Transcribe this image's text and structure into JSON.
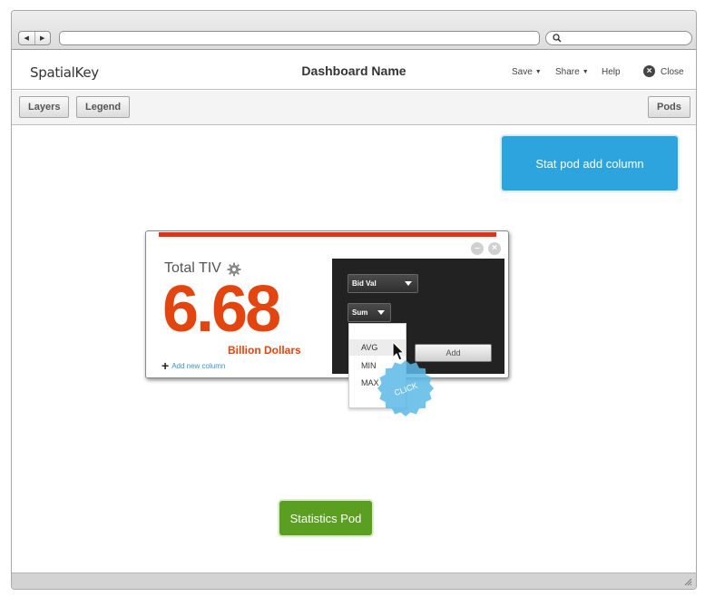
{
  "header": {
    "logo": "SpatialKey",
    "dashboard_name": "Dashboard Name",
    "menu": [
      {
        "label": "Save",
        "has_caret": true
      },
      {
        "label": "Share",
        "has_caret": true
      },
      {
        "label": "Help",
        "has_caret": false
      }
    ],
    "close_label": "Close",
    "close_icon": "×"
  },
  "toolbar": {
    "layers_label": "Layers",
    "legend_label": "Legend",
    "pods_label": "Pods"
  },
  "notes": {
    "blue": "Stat pod add column",
    "green": "Statistics Pod",
    "blue_color": "#2ea4de",
    "green_color": "#5a9e22"
  },
  "pod": {
    "title": "Total TIV",
    "value": "6.68",
    "units": "Billion Dollars",
    "add_column_label": "Add new column",
    "accent_color": "#e2450f",
    "bar_color": "#e03217",
    "field_select": "Bid Val",
    "agg_select": "Sum",
    "add_button": "Add",
    "minimize_icon": "–",
    "close_icon": "×"
  },
  "dropdown": {
    "options": [
      "AVG",
      "MIN",
      "MAX"
    ],
    "hovered": "AVG"
  },
  "click_badge": "CLICK"
}
